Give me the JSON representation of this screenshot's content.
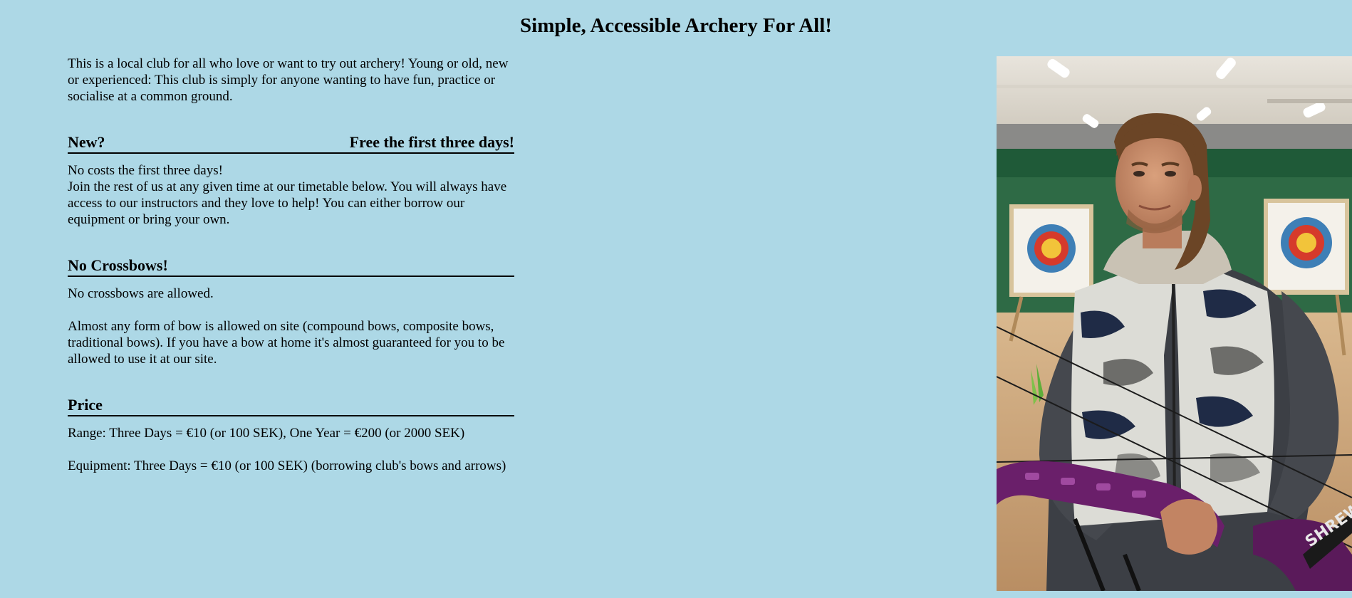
{
  "page": {
    "title": "Simple, Accessible Archery For All!"
  },
  "intro": {
    "text": "This is a local club for all who love or want to try out archery! Young or old, new or experienced: This club is simply for anyone wanting to have fun, practice or socialise at a common ground."
  },
  "sections": {
    "new": {
      "heading": "New?",
      "heading_right": "Free the first three days!",
      "line1": "No costs the first three days!",
      "line2": "Join the rest of us at any given time at our timetable below. You will always have access to our instructors and they love to help! You can either borrow our equipment or bring your own."
    },
    "crossbows": {
      "heading": "No Crossbows!",
      "line1": "No crossbows are allowed.",
      "line2": "Almost any form of bow is allowed on site (compound bows, composite bows, traditional bows). If you have a bow at home it's almost guaranteed for you to be allowed to use it at our site."
    },
    "price": {
      "heading": "Price",
      "line1": "Range: Three Days = €10 (or 100 SEK), One Year = €200 (or 2000 SEK)",
      "line2": "Equipment: Three Days = €10 (or 100 SEK) (borrowing club's bows and arrows)"
    }
  },
  "photo": {
    "bow_brand_text": "SHREW"
  },
  "colors": {
    "background": "#add8e6",
    "text": "#000000"
  }
}
